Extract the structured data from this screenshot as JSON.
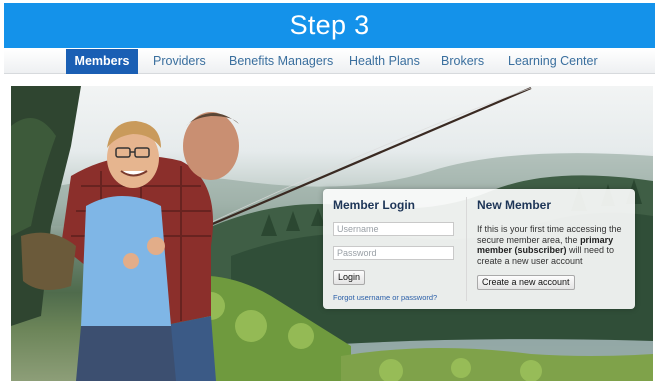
{
  "banner": {
    "title": "Step 3"
  },
  "nav": {
    "items": [
      {
        "label": "Members",
        "active": true
      },
      {
        "label": "Providers",
        "active": false
      },
      {
        "label": "Benefits Managers",
        "active": false
      },
      {
        "label": "Health Plans",
        "active": false
      },
      {
        "label": "Brokers",
        "active": false
      },
      {
        "label": "Learning Center",
        "active": false
      }
    ]
  },
  "login": {
    "title": "Member Login",
    "username_placeholder": "Username",
    "password_placeholder": "Password",
    "login_button": "Login",
    "forgot_link": "Forgot username or password?"
  },
  "new_member": {
    "title": "New Member",
    "desc_part1": "If this is your first time accessing the secure member area, the ",
    "desc_bold": "primary member (subscriber)",
    "desc_part2": " will need to create a new user account",
    "create_button": "Create a new account"
  },
  "colors": {
    "banner_bg": "#1492ea",
    "nav_active_bg": "#1a5fb4",
    "nav_text": "#3a6f9e",
    "panel_title": "#1d3557",
    "link": "#2b5fa8"
  }
}
